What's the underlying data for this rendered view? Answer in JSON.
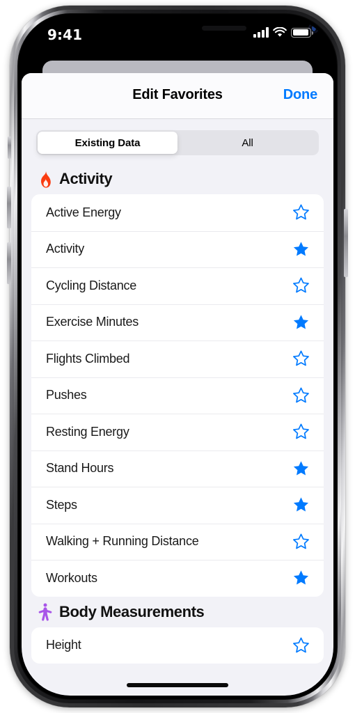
{
  "status_bar": {
    "time": "9:41",
    "signal_icon": "cellular-signal-icon",
    "wifi_icon": "wifi-icon",
    "battery_icon": "battery-icon"
  },
  "navbar": {
    "title": "Edit Favorites",
    "done_label": "Done"
  },
  "segmented_control": {
    "options": [
      {
        "label": "Existing Data",
        "selected": true
      },
      {
        "label": "All",
        "selected": false
      }
    ]
  },
  "colors": {
    "accent_blue": "#007AFF",
    "activity_orange": "#FA3C11",
    "body_purple": "#A855E8",
    "sheet_background": "#F2F2F7",
    "card_white": "#FFFFFF",
    "separator": "#EAEAEE"
  },
  "sections": [
    {
      "title": "Activity",
      "icon": "flame-icon",
      "icon_color": "#FA3C11",
      "rows": [
        {
          "label": "Active Energy",
          "favorited": false
        },
        {
          "label": "Activity",
          "favorited": true
        },
        {
          "label": "Cycling Distance",
          "favorited": false
        },
        {
          "label": "Exercise Minutes",
          "favorited": true
        },
        {
          "label": "Flights Climbed",
          "favorited": false
        },
        {
          "label": "Pushes",
          "favorited": false
        },
        {
          "label": "Resting Energy",
          "favorited": false
        },
        {
          "label": "Stand Hours",
          "favorited": true
        },
        {
          "label": "Steps",
          "favorited": true
        },
        {
          "label": "Walking + Running Distance",
          "favorited": false
        },
        {
          "label": "Workouts",
          "favorited": true
        }
      ]
    },
    {
      "title": "Body Measurements",
      "icon": "body-figure-icon",
      "icon_color": "#A855E8",
      "rows": [
        {
          "label": "Height",
          "favorited": false
        }
      ]
    }
  ]
}
